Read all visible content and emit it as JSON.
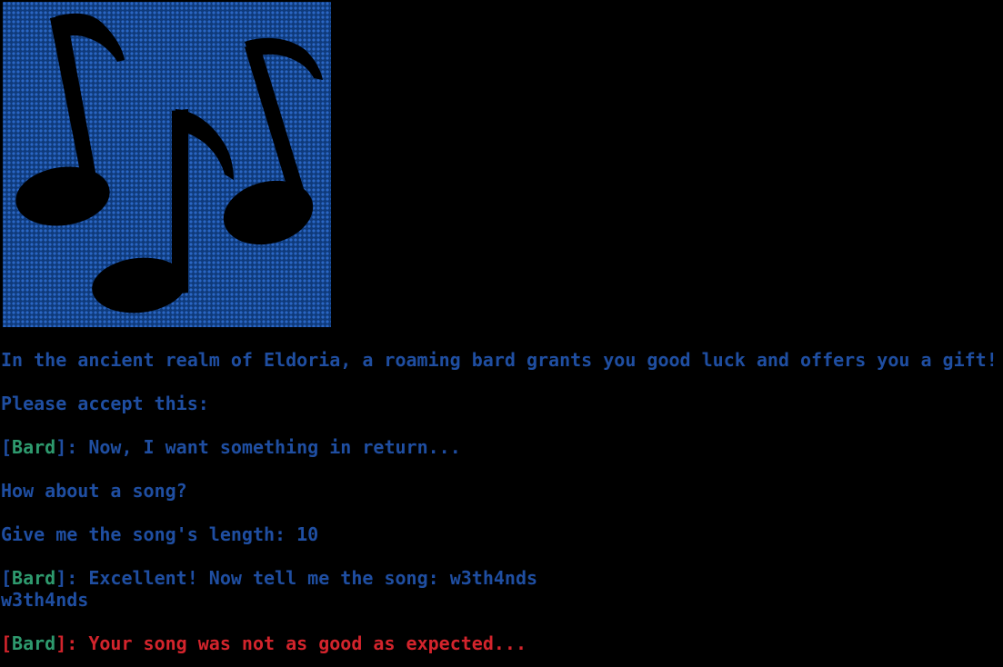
{
  "terminal": {
    "faint_header": "",
    "intro": "In the ancient realm of Eldoria, a roaming bard grants you good luck and offers you a gift!",
    "accept": "Please accept this:",
    "bard_name": "Bard",
    "bard_line_1": ": Now, I want something in return...",
    "song_question": "How about a song?",
    "length_prompt": "Give me the song's length: 10",
    "bard_line_2": ": Excellent! Now tell me the song: w3th4nds",
    "echo": "w3th4nds",
    "bard_line_3": ": Your song was not as good as expected..."
  },
  "art": {
    "icon": "music-notes-icon"
  },
  "colors": {
    "text_blue": "#1f4ea1",
    "bard_green": "#2e9a6e",
    "error_red": "#d3242c",
    "background": "#000000"
  }
}
